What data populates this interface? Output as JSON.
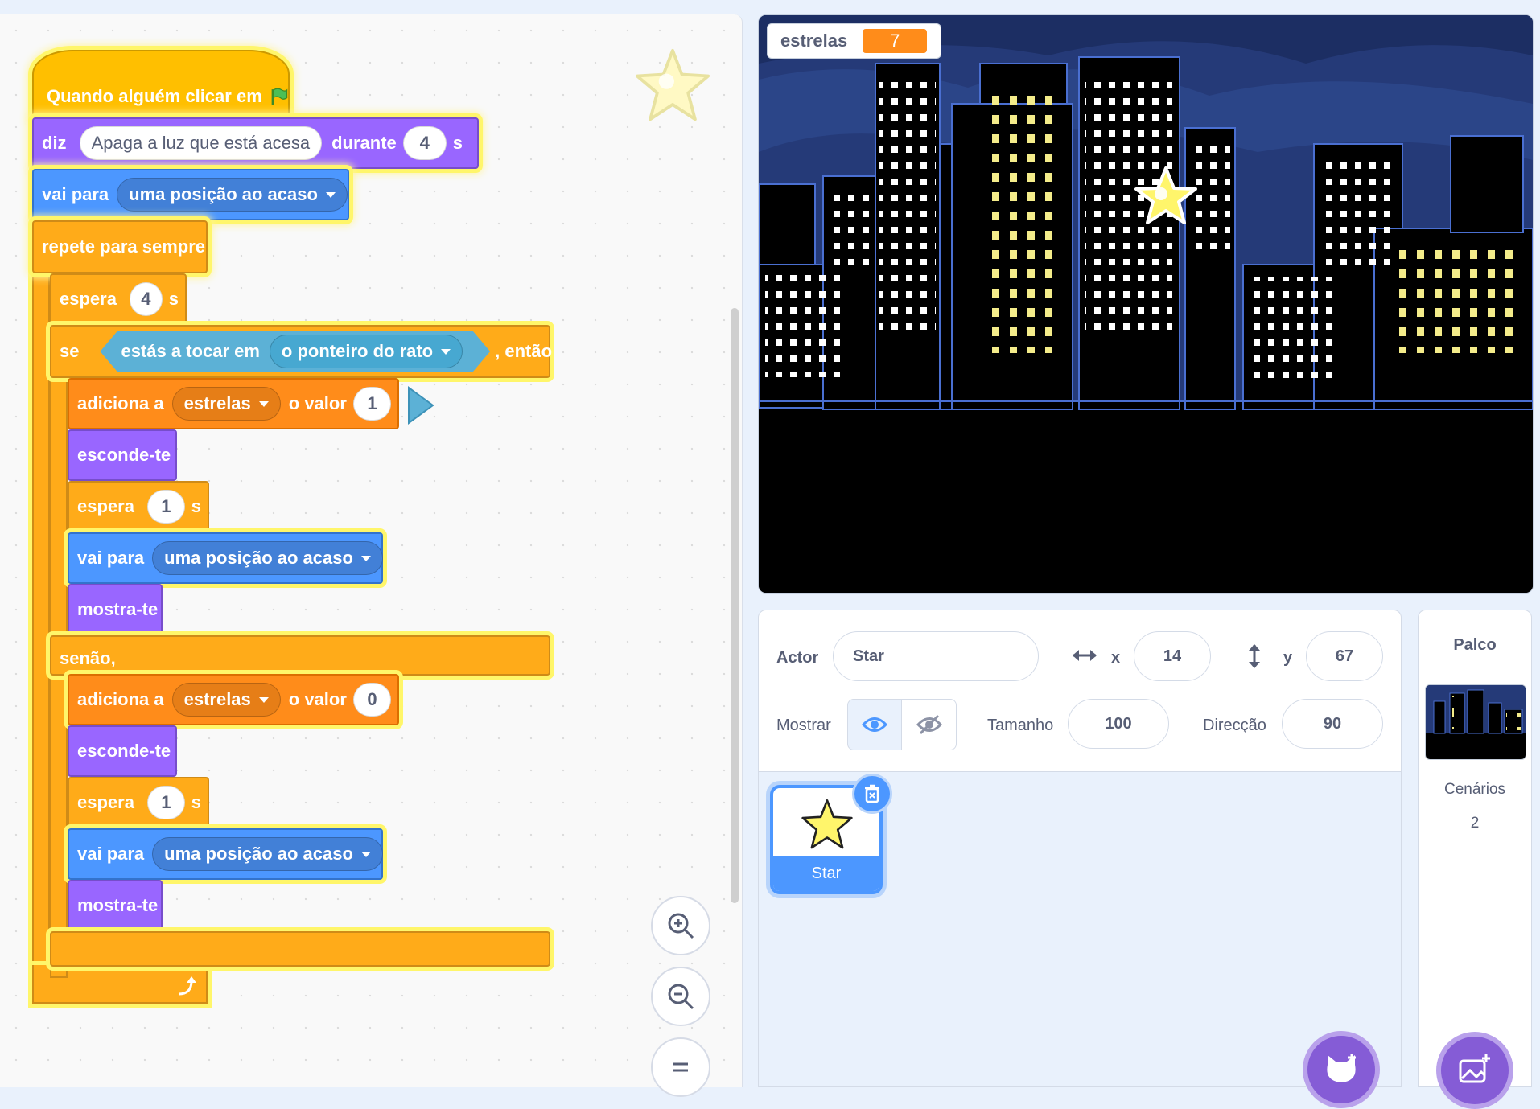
{
  "workspace": {
    "script": {
      "hat": {
        "label": "Quando alguém clicar em",
        "icon": "green-flag-icon"
      },
      "say": {
        "label": "diz",
        "message": "Apaga a luz que está acesa",
        "for_label": "durante",
        "secs": "4",
        "unit": "s"
      },
      "goto1": {
        "label": "vai para",
        "target": "uma posição ao acaso"
      },
      "forever": {
        "label": "repete para sempre"
      },
      "wait_outer": {
        "label": "espera",
        "secs": "4",
        "unit": "s"
      },
      "if_block": {
        "label": "se",
        "condition_label": "estás a tocar em",
        "condition_target": "o ponteiro do rato",
        "then_label": ", então",
        "else_label": "senão,"
      },
      "then": {
        "change": {
          "label": "adiciona a",
          "variable": "estrelas",
          "value_label": "o valor",
          "value": "1"
        },
        "hide": {
          "label": "esconde-te"
        },
        "wait": {
          "label": "espera",
          "secs": "1",
          "unit": "s"
        },
        "goto": {
          "label": "vai para",
          "target": "uma posição ao acaso"
        },
        "show": {
          "label": "mostra-te"
        }
      },
      "else": {
        "change": {
          "label": "adiciona a",
          "variable": "estrelas",
          "value_label": "o valor",
          "value": "0"
        },
        "hide": {
          "label": "esconde-te"
        },
        "wait": {
          "label": "espera",
          "secs": "1",
          "unit": "s"
        },
        "goto": {
          "label": "vai para",
          "target": "uma posição ao acaso"
        },
        "show": {
          "label": "mostra-te"
        }
      }
    },
    "zoom": {
      "in_icon": "zoom-in-icon",
      "out_icon": "zoom-out-icon",
      "reset_icon": "zoom-reset-icon"
    }
  },
  "stage": {
    "monitor": {
      "name": "estrelas",
      "value": "7"
    }
  },
  "sprite_info": {
    "actor_label": "Actor",
    "actor_name": "Star",
    "x_label": "x",
    "x_value": "14",
    "y_label": "y",
    "y_value": "67",
    "show_label": "Mostrar",
    "size_label": "Tamanho",
    "size_value": "100",
    "direction_label": "Direcção",
    "direction_value": "90"
  },
  "sprite_list": [
    {
      "name": "Star",
      "selected": true
    }
  ],
  "stage_panel": {
    "title": "Palco",
    "backdrops_label": "Cenários",
    "backdrops_count": "2"
  },
  "colors": {
    "events": "#ffbf00",
    "looks": "#9966ff",
    "motion": "#4c97ff",
    "control": "#ffab19",
    "variables": "#ff8c1a",
    "sensing": "#5cb1d6",
    "glow": "#fff66a"
  }
}
